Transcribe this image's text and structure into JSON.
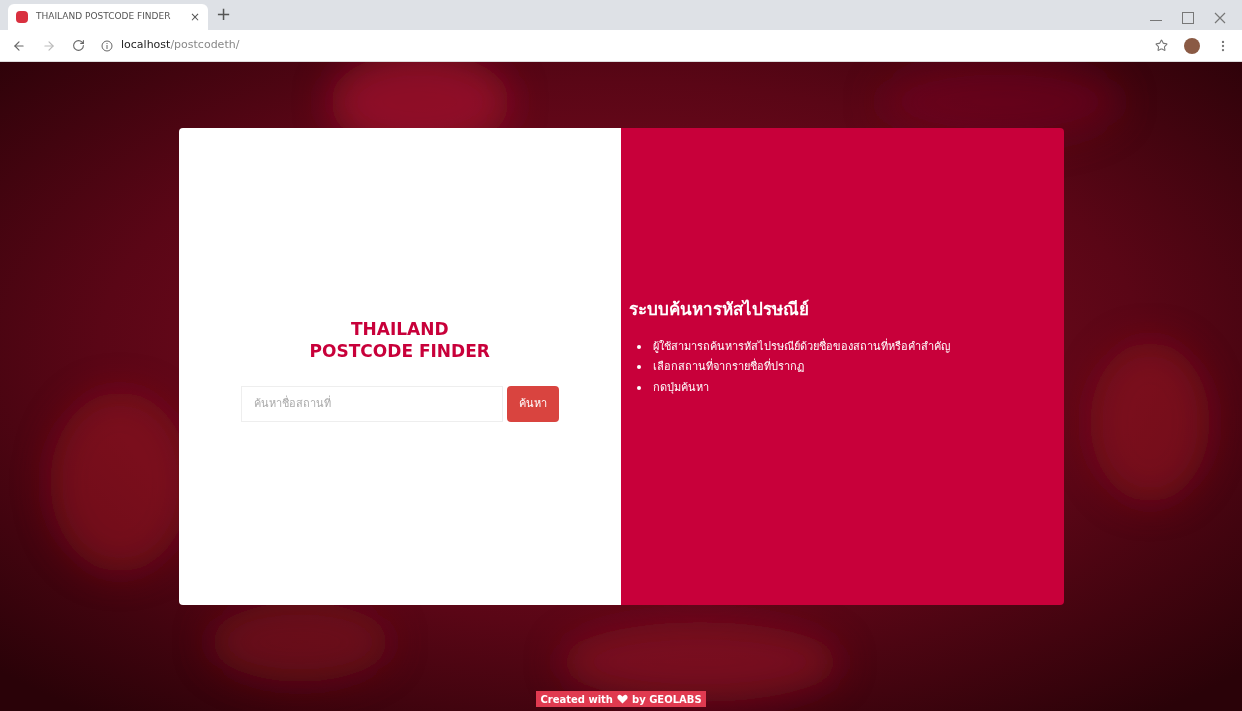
{
  "browser": {
    "tab": {
      "title": "THAILAND POSTCODE FINDER",
      "close": "×",
      "selected": true
    },
    "new_tab": "+",
    "address": {
      "host": "localhost",
      "path": "/postcodeth/"
    }
  },
  "card": {
    "title_lines": [
      "THAILAND",
      "POSTCODE FINDER"
    ],
    "search": {
      "placeholder": "ค้นหาชื่อสถานที่"
    },
    "search_button": "ค้นหา"
  },
  "info": {
    "heading": "ระบบค้นหารหัสไปรษณีย์",
    "bullets": [
      "ผู้ใช้สามารถค้นหารหัสไปรษณีย์ด้วยชื่อของสถานที่หรือคำสำคัญ",
      "เลือกสถานที่จากรายชื่อที่ปรากฏ",
      "กดปุ่มค้นหา"
    ]
  },
  "footer": {
    "before": "Created with",
    "after": "by GEOLABS"
  }
}
